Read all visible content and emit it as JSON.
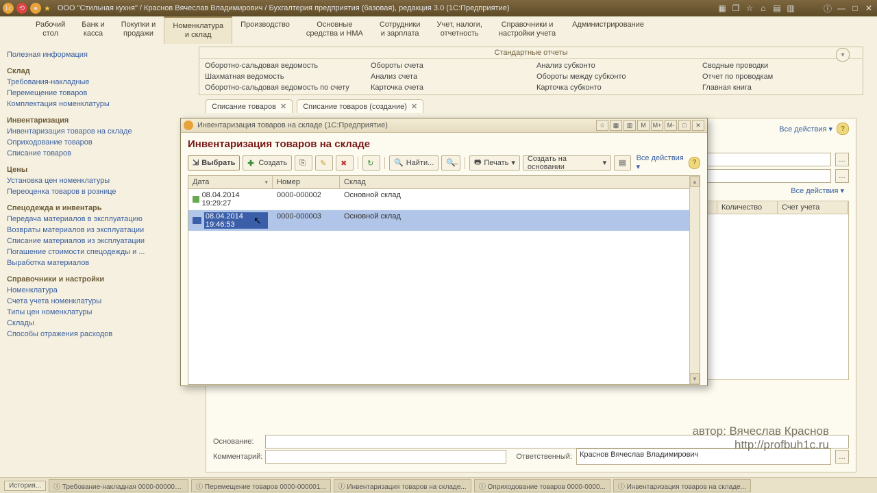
{
  "titlebar": {
    "title": "ООО \"Стильная кухня\" / Краснов Вячеслав Владимирович / Бухгалтерия предприятия (базовая), редакция 3.0  (1С:Предприятие)"
  },
  "mainmenu": [
    {
      "l1": "Рабочий",
      "l2": "стол"
    },
    {
      "l1": "Банк и",
      "l2": "касса"
    },
    {
      "l1": "Покупки и",
      "l2": "продажи"
    },
    {
      "l1": "Номенклатура",
      "l2": "и склад",
      "active": true
    },
    {
      "l1": "Производство",
      "l2": ""
    },
    {
      "l1": "Основные",
      "l2": "средства и НМА"
    },
    {
      "l1": "Сотрудники",
      "l2": "и зарплата"
    },
    {
      "l1": "Учет, налоги,",
      "l2": "отчетность"
    },
    {
      "l1": "Справочники и",
      "l2": "настройки учета"
    },
    {
      "l1": "Администрирование",
      "l2": ""
    }
  ],
  "sidebar": {
    "top_link": "Полезная информация",
    "groups": [
      {
        "title": "Склад",
        "items": [
          "Требования-накладные",
          "Перемещение товаров",
          "Комплектация номенклатуры"
        ]
      },
      {
        "title": "Инвентаризация",
        "items": [
          "Инвентаризация товаров на складе",
          "Оприходование товаров",
          "Списание товаров"
        ]
      },
      {
        "title": "Цены",
        "items": [
          "Установка цен номенклатуры",
          "Переоценка товаров в рознице"
        ]
      },
      {
        "title": "Спецодежда и инвентарь",
        "items": [
          "Передача материалов в эксплуатацию",
          "Возвраты материалов из эксплуатации",
          "Списание материалов из эксплуатации",
          "Погашение стоимости спецодежды и ...",
          "Выработка материалов"
        ]
      },
      {
        "title": "Справочники и настройки",
        "items": [
          "Номенклатура",
          "Счета учета номенклатуры",
          "Типы цен номенклатуры",
          "Склады",
          "Способы отражения расходов"
        ]
      }
    ]
  },
  "reports": {
    "header": "Стандартные отчеты",
    "cols": [
      [
        "Оборотно-сальдовая ведомость",
        "Шахматная ведомость",
        "Оборотно-сальдовая ведомость по счету"
      ],
      [
        "Обороты счета",
        "Анализ счета",
        "Карточка счета"
      ],
      [
        "Анализ субконто",
        "Обороты между субконто",
        "Карточка субконто"
      ],
      [
        "Сводные проводки",
        "Отчет по проводкам",
        "Главная книга"
      ]
    ]
  },
  "doc_tabs": [
    {
      "label": "Списание товаров"
    },
    {
      "label": "Списание товаров (создание)"
    }
  ],
  "doc_body": {
    "all_actions": "Все действия",
    "grid_cols": [
      "Количество",
      "Счет учета"
    ],
    "osn_label": "Основание:",
    "comment_label": "Комментарий:",
    "resp_label": "Ответственный:",
    "resp_value": "Краснов Вячеслав Владимирович"
  },
  "modal": {
    "window_title": "Инвентаризация товаров на складе  (1С:Предприятие)",
    "heading": "Инвентаризация товаров на складе",
    "toolbar": {
      "select": "Выбрать",
      "create": "Создать",
      "find": "Найти...",
      "print": "Печать",
      "create_based": "Создать на основании",
      "all_actions": "Все действия"
    },
    "right_btns": [
      "M",
      "M+",
      "M-"
    ],
    "columns": {
      "date": "Дата",
      "num": "Номер",
      "wh": "Склад"
    },
    "rows": [
      {
        "date": "08.04.2014 19:29:27",
        "num": "0000-000002",
        "wh": "Основной склад",
        "sel": false
      },
      {
        "date": "08.04.2014 19:46:53",
        "num": "0000-000003",
        "wh": "Основной склад",
        "sel": true
      }
    ]
  },
  "taskbar": {
    "history": "История...",
    "items": [
      "Требование-накладная 0000-000001...",
      "Перемещение товаров 0000-000001...",
      "Инвентаризация товаров на складе...",
      "Оприходование товаров 0000-0000...",
      "Инвентаризация товаров на складе..."
    ]
  },
  "watermark": {
    "l1": "автор: Вячеслав Краснов",
    "l2": "http://profbuh1c.ru"
  }
}
